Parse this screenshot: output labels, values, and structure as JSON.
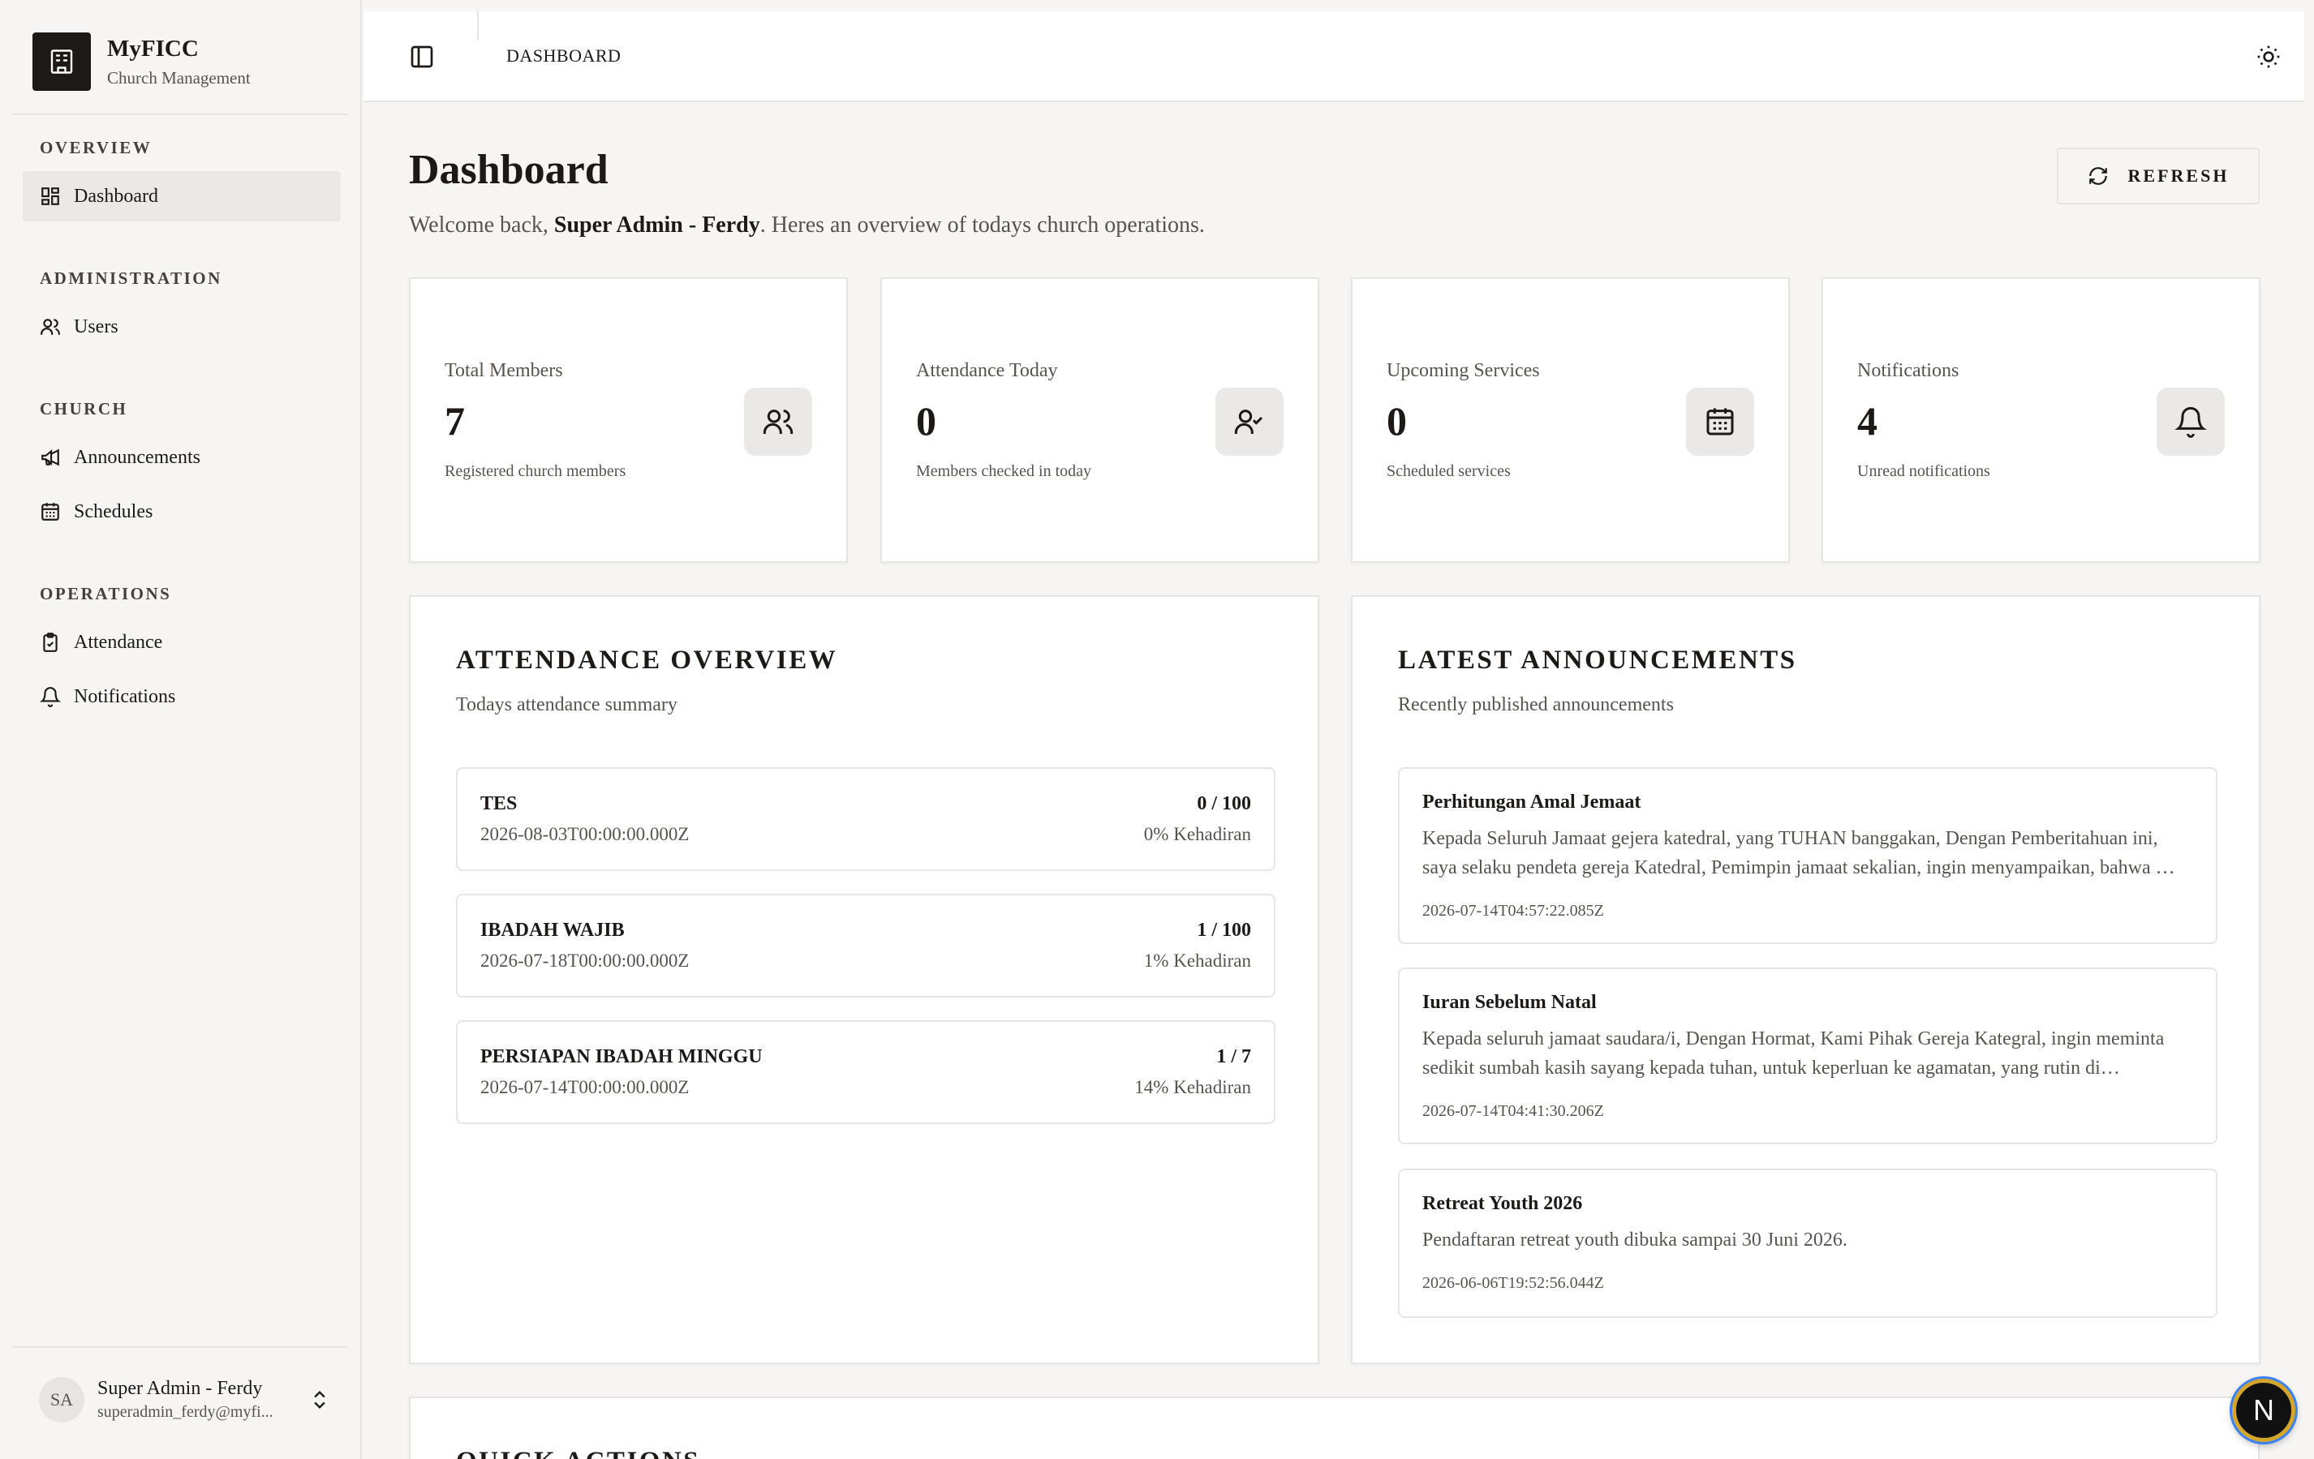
{
  "brand": {
    "name": "MyFICC",
    "subtitle": "Church Management"
  },
  "sidebar": {
    "groups": [
      {
        "label": "OVERVIEW",
        "items": [
          {
            "label": "Dashboard",
            "icon": "dashboard-icon",
            "active": true
          }
        ]
      },
      {
        "label": "ADMINISTRATION",
        "items": [
          {
            "label": "Users",
            "icon": "users-icon"
          }
        ]
      },
      {
        "label": "CHURCH",
        "items": [
          {
            "label": "Announcements",
            "icon": "megaphone-icon"
          },
          {
            "label": "Schedules",
            "icon": "calendar-icon"
          }
        ]
      },
      {
        "label": "OPERATIONS",
        "items": [
          {
            "label": "Attendance",
            "icon": "clipboard-check-icon"
          },
          {
            "label": "Notifications",
            "icon": "bell-icon"
          }
        ]
      }
    ],
    "user": {
      "initials": "SA",
      "name": "Super Admin - Ferdy",
      "email": "superadmin_ferdy@myfi..."
    }
  },
  "topbar": {
    "breadcrumb": "DASHBOARD"
  },
  "header": {
    "title": "Dashboard",
    "welcome_prefix": "Welcome back, ",
    "welcome_name": "Super Admin - Ferdy",
    "welcome_suffix": ". Heres an overview of todays church operations.",
    "refresh_label": "REFRESH"
  },
  "stats": [
    {
      "label": "Total Members",
      "value": "7",
      "desc": "Registered church members",
      "icon": "users-icon"
    },
    {
      "label": "Attendance Today",
      "value": "0",
      "desc": "Members checked in today",
      "icon": "user-check-icon"
    },
    {
      "label": "Upcoming Services",
      "value": "0",
      "desc": "Scheduled services",
      "icon": "calendar-icon"
    },
    {
      "label": "Notifications",
      "value": "4",
      "desc": "Unread notifications",
      "icon": "bell-icon"
    }
  ],
  "attendance": {
    "title": "ATTENDANCE OVERVIEW",
    "subtitle": "Todays attendance summary",
    "rows": [
      {
        "name": "TES",
        "date": "2026-08-03T00:00:00.000Z",
        "count": "0 / 100",
        "pct": "0% Kehadiran"
      },
      {
        "name": "IBADAH WAJIB",
        "date": "2026-07-18T00:00:00.000Z",
        "count": "1 / 100",
        "pct": "1% Kehadiran"
      },
      {
        "name": "PERSIAPAN IBADAH MINGGU",
        "date": "2026-07-14T00:00:00.000Z",
        "count": "1 / 7",
        "pct": "14% Kehadiran"
      }
    ]
  },
  "announcements": {
    "title": "LATEST ANNOUNCEMENTS",
    "subtitle": "Recently published announcements",
    "items": [
      {
        "title": "Perhitungan Amal Jemaat",
        "body": "Kepada Seluruh Jamaat gejera katedral, yang TUHAN banggakan, Dengan Pemberitahuan ini, saya selaku pendeta gereja Katedral, Pemimpin jamaat sekalian, ingin menyampaikan, bahwa …",
        "date": "2026-07-14T04:57:22.085Z"
      },
      {
        "title": "Iuran Sebelum Natal",
        "body": "Kepada seluruh jamaat saudara/i, Dengan Hormat, Kami Pihak Gereja Kategral, ingin meminta sedikit sumbah kasih sayang kepada tuhan, untuk keperluan ke agamatan, yang rutin di…",
        "date": "2026-07-14T04:41:30.206Z"
      },
      {
        "title": "Retreat Youth 2026",
        "body": "Pendaftaran retreat youth dibuka sampai 30 Juni 2026.",
        "date": "2026-06-06T19:52:56.044Z"
      }
    ]
  },
  "quick_actions": {
    "title": "QUICK ACTIONS"
  },
  "fab": {
    "label": "N"
  }
}
